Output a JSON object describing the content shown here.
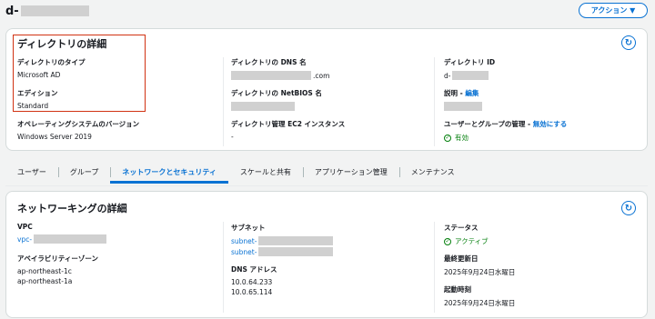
{
  "header": {
    "title": "d-",
    "action_label": "アクション ▼"
  },
  "directory_details": {
    "title": "ディレクトリの詳細",
    "type_label": "ディレクトリのタイプ",
    "type_value": "Microsoft AD",
    "edition_label": "エディション",
    "edition_value": "Standard",
    "os_label": "オペレーティングシステムのバージョン",
    "os_value": "Windows Server 2019",
    "dns_label": "ディレクトリの DNS 名",
    "dns_value_suffix": ".com",
    "netbios_label": "ディレクトリの NetBIOS 名",
    "ec2_label": "ディレクトリ管理 EC2 インスタンス",
    "ec2_value": "-",
    "id_label": "ディレクトリ ID",
    "id_value": "d-",
    "desc_label": "説明 - ",
    "desc_edit": "編集",
    "user_mgmt_label": "ユーザーとグループの管理 - ",
    "user_mgmt_link": "無効にする",
    "user_mgmt_status": "有効"
  },
  "tabs": [
    {
      "label": "ユーザー"
    },
    {
      "label": "グループ"
    },
    {
      "label": "ネットワークとセキュリティ"
    },
    {
      "label": "スケールと共有"
    },
    {
      "label": "アプリケーション管理"
    },
    {
      "label": "メンテナンス"
    }
  ],
  "networking": {
    "title": "ネットワーキングの詳細",
    "vpc_label": "VPC",
    "vpc_value": "vpc-",
    "az_label": "アベイラビリティーゾーン",
    "az_values": [
      "ap-northeast-1c",
      "ap-northeast-1a"
    ],
    "subnet_label": "サブネット",
    "subnet_values": [
      "subnet-",
      "subnet-"
    ],
    "dns_label": "DNS アドレス",
    "dns_values": [
      "10.0.64.233",
      "10.0.65.114"
    ],
    "status_label": "ステータス",
    "status_value": "アクティブ",
    "updated_label": "最終更新日",
    "updated_value": "2025年9月24日水曜日",
    "launched_label": "起動時刻",
    "launched_value": "2025年9月24日水曜日"
  },
  "colors": {
    "accent": "#0972d3",
    "success": "#037f0c",
    "highlight_border": "#d13212"
  },
  "icons": {
    "refresh": "refresh-icon",
    "status_ok": "check-circle-icon",
    "dropdown": "caret-down-icon"
  }
}
